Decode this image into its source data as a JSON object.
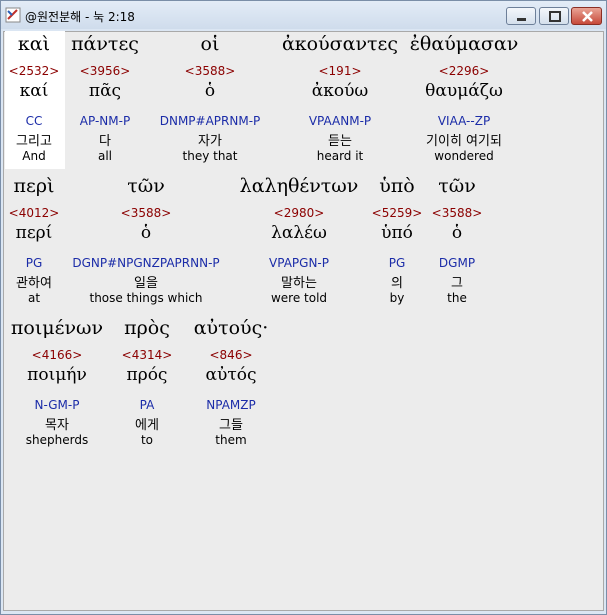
{
  "window": {
    "title": "@원전분해 - 눅 2:18"
  },
  "controls": {
    "minimize": "minimize",
    "maximize": "maximize",
    "close": "close"
  },
  "words": [
    {
      "greek": "καὶ",
      "strong": "<2532>",
      "lemma": "καί",
      "parse": "CC",
      "kor": "그리고",
      "eng": "And"
    },
    {
      "greek": "πάντες",
      "strong": "<3956>",
      "lemma": "πᾶς",
      "parse": "AP-NM-P",
      "kor": "다",
      "eng": "all"
    },
    {
      "greek": "οἱ",
      "strong": "<3588>",
      "lemma": "ὁ",
      "parse": "DNMP#APRNM-P",
      "kor": "자가",
      "eng": "they that"
    },
    {
      "greek": "ἀκούσαντες",
      "strong": "<191>",
      "lemma": "ἀκούω",
      "parse": "VPAANM-P",
      "kor": "듣는",
      "eng": "heard it"
    },
    {
      "greek": "ἐθαύμασαν",
      "strong": "<2296>",
      "lemma": "θαυμάζω",
      "parse": "VIAA--ZP",
      "kor": "기이히 여기되",
      "eng": "wondered"
    },
    {
      "greek": "περὶ",
      "strong": "<4012>",
      "lemma": "περί",
      "parse": "PG",
      "kor": "관하여",
      "eng": "at"
    },
    {
      "greek": "τῶν",
      "strong": "<3588>",
      "lemma": "ὁ",
      "parse": "DGNP#NPGNZPAPRNN-P",
      "kor": "일을",
      "eng": "those things which"
    },
    {
      "greek": "λαληθέντων",
      "strong": "<2980>",
      "lemma": "λαλέω",
      "parse": "VPAPGN-P",
      "kor": "말하는",
      "eng": "were told"
    },
    {
      "greek": "ὑπὸ",
      "strong": "<5259>",
      "lemma": "ὑπό",
      "parse": "PG",
      "kor": "의",
      "eng": "by"
    },
    {
      "greek": "τῶν",
      "strong": "<3588>",
      "lemma": "ὁ",
      "parse": "DGMP",
      "kor": "그",
      "eng": "the"
    },
    {
      "greek": "ποιμένων",
      "strong": "<4166>",
      "lemma": "ποιμήν",
      "parse": "N-GM-P",
      "kor": "목자",
      "eng": "shepherds"
    },
    {
      "greek": "πρὸς",
      "strong": "<4314>",
      "lemma": "πρός",
      "parse": "PA",
      "kor": "에게",
      "eng": "to"
    },
    {
      "greek": "αὐτούς·",
      "strong": "<846>",
      "lemma": "αὐτός",
      "parse": "NPAMZP",
      "kor": "그들",
      "eng": "them"
    }
  ]
}
